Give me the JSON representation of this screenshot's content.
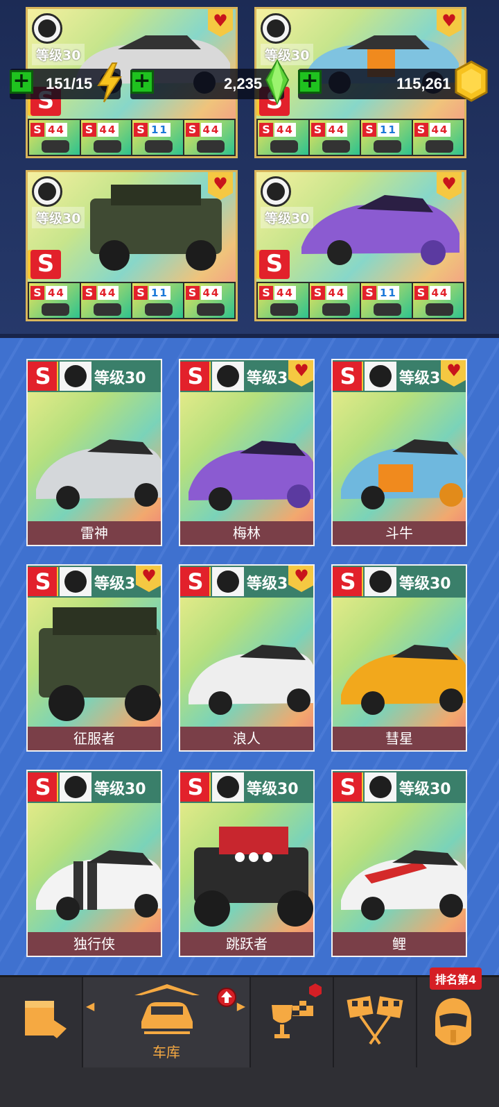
{
  "currency": {
    "fuel": "151/15",
    "gems": "2,235",
    "coins": "115,261"
  },
  "top_cards": [
    {
      "level": "等级30",
      "ss": "S",
      "upgrades": [
        {
          "s": "S",
          "n": "44"
        },
        {
          "s": "S",
          "n": "44"
        },
        {
          "s": "S",
          "n": "11"
        },
        {
          "s": "S",
          "n": "44"
        }
      ]
    },
    {
      "level": "等级30",
      "ss": "S",
      "upgrades": [
        {
          "s": "S",
          "n": "44"
        },
        {
          "s": "S",
          "n": "44"
        },
        {
          "s": "S",
          "n": "11"
        },
        {
          "s": "S",
          "n": "44"
        }
      ]
    },
    {
      "level": "等级30",
      "ss": "S",
      "upgrades": [
        {
          "s": "S",
          "n": "44"
        },
        {
          "s": "S",
          "n": "44"
        },
        {
          "s": "S",
          "n": "11"
        },
        {
          "s": "S",
          "n": "44"
        }
      ]
    },
    {
      "level": "等级30",
      "ss": "S",
      "upgrades": [
        {
          "s": "S",
          "n": "44"
        },
        {
          "s": "S",
          "n": "44"
        },
        {
          "s": "S",
          "n": "11"
        },
        {
          "s": "S",
          "n": "44"
        }
      ]
    }
  ],
  "garage_cars": [
    {
      "name": "雷神",
      "level": "等级30",
      "ss": "S",
      "favorite": false,
      "color": "#cfd3d6"
    },
    {
      "name": "梅林",
      "level": "等级3",
      "ss": "S",
      "favorite": true,
      "color": "#8b5bd1"
    },
    {
      "name": "斗牛",
      "level": "等级3",
      "ss": "S",
      "favorite": true,
      "color": "#6fb8de"
    },
    {
      "name": "征服者",
      "level": "等级3",
      "ss": "S",
      "favorite": true,
      "color": "#3e4a32"
    },
    {
      "name": "浪人",
      "level": "等级3",
      "ss": "S",
      "favorite": true,
      "color": "#eeeeee"
    },
    {
      "name": "彗星",
      "level": "等级30",
      "ss": "S",
      "favorite": false,
      "color": "#f2a81c"
    },
    {
      "name": "独行侠",
      "level": "等级30",
      "ss": "S",
      "favorite": false,
      "color": "#f3f3f3"
    },
    {
      "name": "跳跃者",
      "level": "等级30",
      "ss": "S",
      "favorite": false,
      "color": "#2b2b2b"
    },
    {
      "name": "鲤",
      "level": "等级30",
      "ss": "S",
      "favorite": false,
      "color": "#f2f2f2"
    }
  ],
  "nav": {
    "garage_label": "车库",
    "rank_badge": "排名第4"
  },
  "colors": {
    "accent": "#f5a942",
    "heart": "#c8141b",
    "plus": "#1fc21f"
  }
}
